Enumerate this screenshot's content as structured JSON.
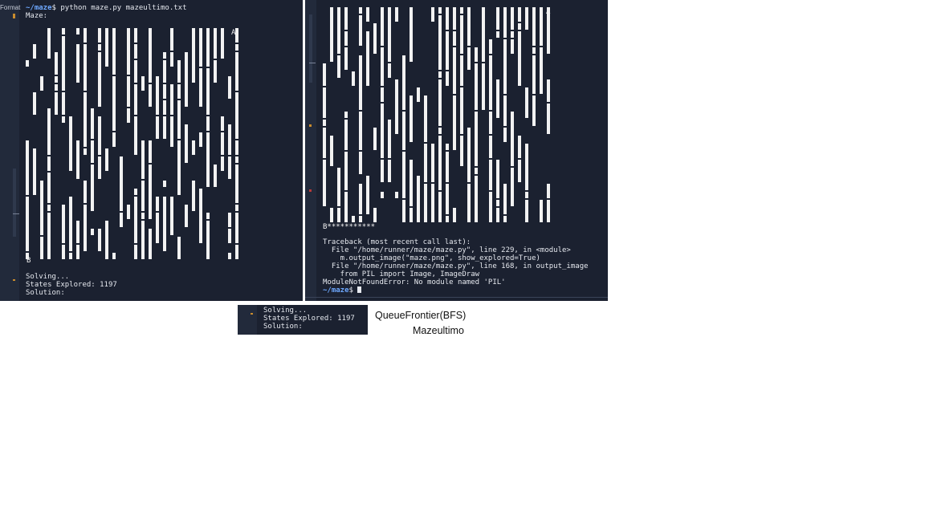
{
  "left_terminal": {
    "gutter_label": "Format",
    "prompt_path": "~/maze",
    "command": "$ python maze.py mazeultimo.txt",
    "maze_label": "Maze:",
    "start_marker": "A",
    "goal_marker": "B",
    "output_lines": [
      "Solving...",
      "States Explored: 1197",
      "Solution:"
    ]
  },
  "right_terminal": {
    "start_marker": "A",
    "goal_marker": "B",
    "goal_trail": "***********",
    "traceback_lines": [
      "Traceback (most recent call last):",
      "  File \"/home/runner/maze/maze.py\", line 229, in <module>",
      "    m.output_image(\"maze.png\", show_explored=True)",
      "  File \"/home/runner/maze/maze.py\", line 168, in output_image",
      "    from PIL import Image, ImageDraw",
      "ModuleNotFoundError: No module named 'PIL'"
    ],
    "prompt_path": "~/maze",
    "prompt_suffix": "$ "
  },
  "mini_terminal": {
    "output_lines": [
      "Solving...",
      "States Explored: 1197",
      "Solution:"
    ]
  },
  "captions": {
    "frontier": "QueueFrontier(BFS)",
    "maze_name": "Mazeultimo"
  },
  "colors": {
    "terminal_bg": "#1b2130",
    "prompt_path": "#6ea8ff",
    "gutter_mark": "#c98c2e"
  }
}
